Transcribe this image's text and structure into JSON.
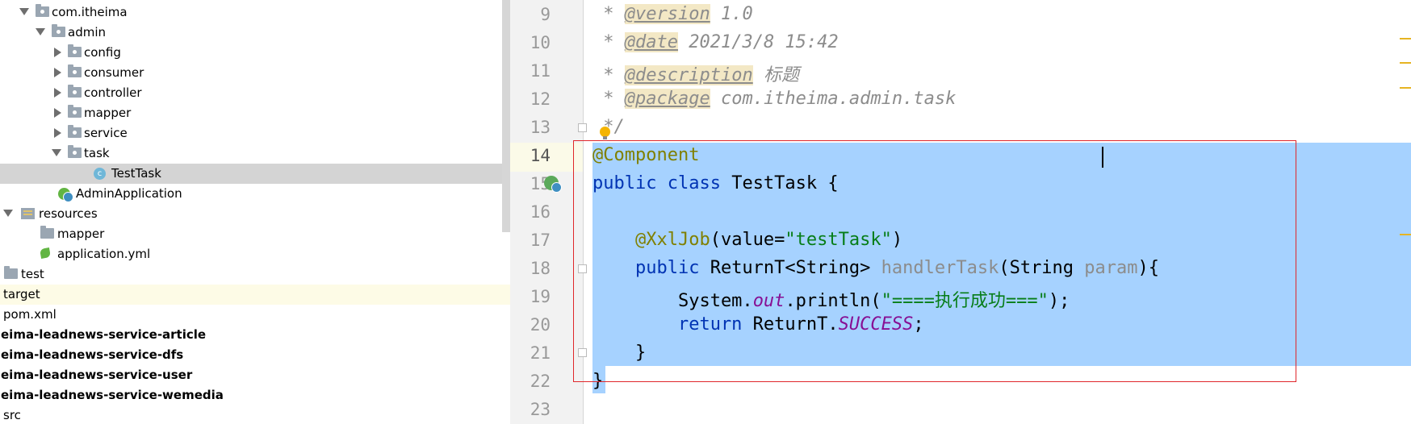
{
  "tree": {
    "items": [
      {
        "label": "com.itheima",
        "indent": 1
      },
      {
        "label": "admin",
        "indent": 2
      },
      {
        "label": "config"
      },
      {
        "label": "consumer"
      },
      {
        "label": "controller"
      },
      {
        "label": "mapper"
      },
      {
        "label": "service"
      },
      {
        "label": "task"
      },
      {
        "label": "TestTask",
        "selected": true
      },
      {
        "label": "AdminApplication"
      },
      {
        "label": "resources"
      },
      {
        "label": "mapper"
      },
      {
        "label": "application.yml"
      },
      {
        "label": "test"
      },
      {
        "label": "target"
      },
      {
        "label": "pom.xml"
      },
      {
        "label": "eima-leadnews-service-article"
      },
      {
        "label": "eima-leadnews-service-dfs"
      },
      {
        "label": "eima-leadnews-service-user"
      },
      {
        "label": "eima-leadnews-service-wemedia"
      },
      {
        "label": "src"
      }
    ]
  },
  "editor": {
    "line_numbers": [
      "9",
      "10",
      "11",
      "12",
      "13",
      "14",
      "15",
      "16",
      "17",
      "18",
      "19",
      "20",
      "21",
      "22",
      "23"
    ],
    "code": {
      "l9_star": " * ",
      "l9_tag": "@version",
      "l9_rest": " 1.0",
      "l10_star": " * ",
      "l10_tag": "@date",
      "l10_rest": " 2021/3/8 15:42",
      "l11_star": " * ",
      "l11_tag": "@description",
      "l11_rest": " 标题",
      "l12_star": " * ",
      "l12_tag": "@package",
      "l12_rest": " com.itheima.admin.task",
      "l13": " */",
      "l14_ann": "@Component",
      "l15_kw": "public class",
      "l15_rest": " TestTask {",
      "l17_ann": "    @XxlJob",
      "l17_a": "(value=",
      "l17_str": "\"testTask\"",
      "l17_b": ")",
      "l18_kw": "    public",
      "l18_a": " ReturnT<String> ",
      "l18_method": "handlerTask",
      "l18_b": "(String ",
      "l18_param": "param",
      "l18_c": "){",
      "l19_a": "        System.",
      "l19_field": "out",
      "l19_b": ".println(",
      "l19_str": "\"====执行成功===\"",
      "l19_c": ");",
      "l20_kw": "        return",
      "l20_a": " ReturnT.",
      "l20_field": "SUCCESS",
      "l20_b": ";",
      "l21": "    }",
      "l22": "}"
    }
  },
  "colors": {
    "selection": "#a6d2ff",
    "annotation": "#808000",
    "keyword": "#0033b3",
    "string": "#067d17",
    "highlight_box": "#e0272b"
  }
}
